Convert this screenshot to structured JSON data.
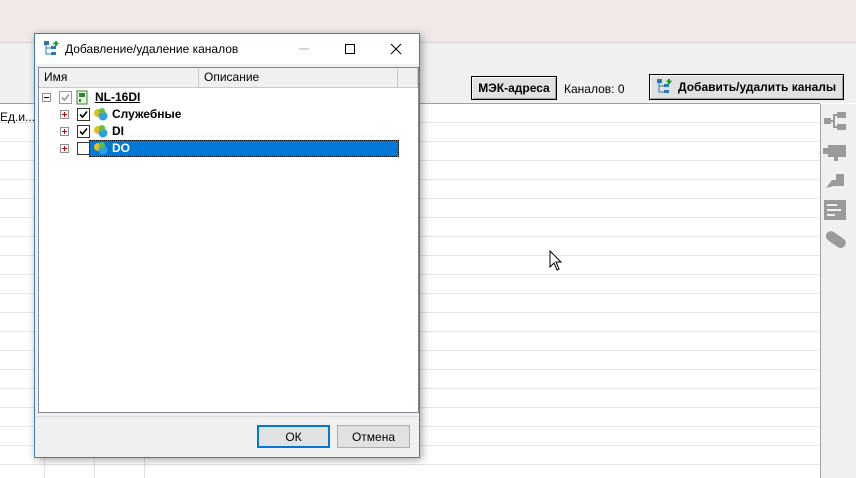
{
  "background_app": {
    "mek_button_label": "МЭК-адреса",
    "channels_count_label": "Каналов: 0",
    "add_remove_button_label": "Добавить/удалить каналы",
    "grid_header_unit": "Ед.и..."
  },
  "right_panel": {
    "icons": [
      "tree-branch-icon",
      "camera-icon",
      "projector-icon",
      "form-icon",
      "pill-icon"
    ]
  },
  "dialog": {
    "title": "Добавление/удаление каналов",
    "columns": [
      "Имя",
      "Описание"
    ],
    "tree": [
      {
        "label": "NL-16DI",
        "level": 0,
        "expanded": true,
        "checked": true
      },
      {
        "label": "Служебные",
        "level": 1,
        "expanded": false,
        "checked": true
      },
      {
        "label": "DI",
        "level": 1,
        "expanded": false,
        "checked": true
      },
      {
        "label": "DO",
        "level": 1,
        "expanded": false,
        "checked": false,
        "selected": true
      }
    ],
    "ok_label": "ОК",
    "cancel_label": "Отмена"
  },
  "colors": {
    "selection": "#0078d7",
    "dialog_border": "#3c7fb1",
    "top_band": "#f1e8e8"
  }
}
